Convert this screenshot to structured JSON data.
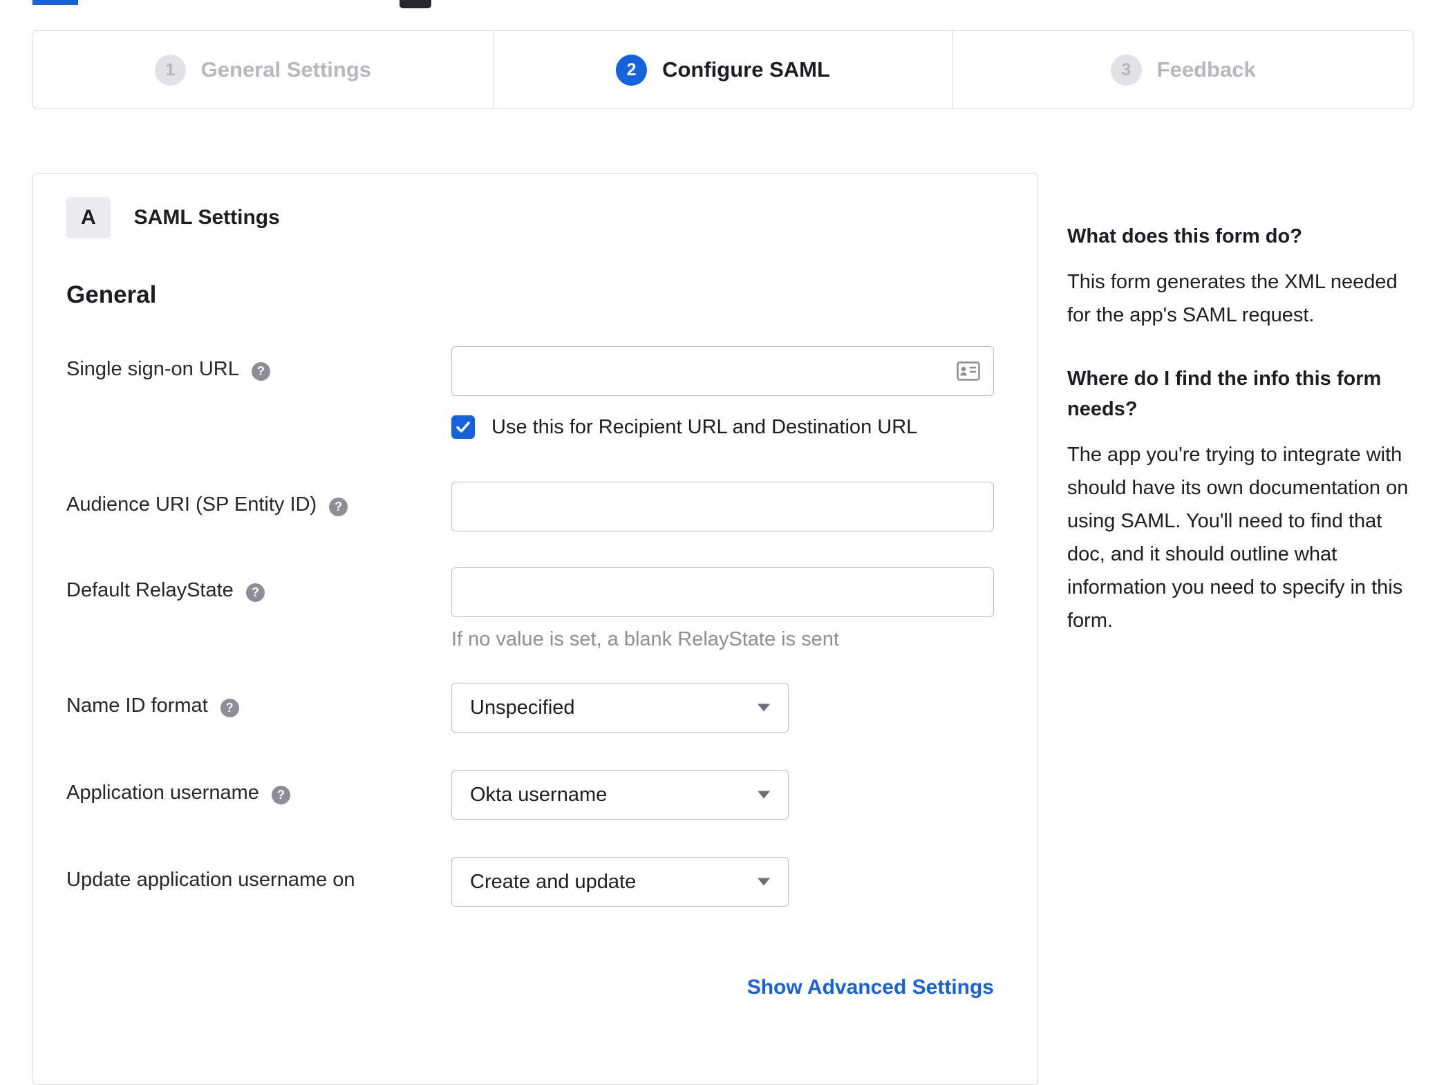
{
  "stepper": {
    "steps": [
      {
        "number": "1",
        "label": "General Settings",
        "state": "inactive"
      },
      {
        "number": "2",
        "label": "Configure SAML",
        "state": "active"
      },
      {
        "number": "3",
        "label": "Feedback",
        "state": "inactive"
      }
    ]
  },
  "panel": {
    "badge": "A",
    "title": "SAML Settings",
    "section_title": "General",
    "fields": {
      "sso": {
        "label": "Single sign-on URL",
        "value": "",
        "checkbox_label": "Use this for Recipient URL and Destination URL",
        "checkbox_checked": true
      },
      "audience": {
        "label": "Audience URI (SP Entity ID)",
        "value": ""
      },
      "relay": {
        "label": "Default RelayState",
        "value": "",
        "hint": "If no value is set, a blank RelayState is sent"
      },
      "nameid": {
        "label": "Name ID format",
        "value": "Unspecified"
      },
      "appuser": {
        "label": "Application username",
        "value": "Okta username"
      },
      "updateuser": {
        "label": "Update application username on",
        "value": "Create and update"
      }
    },
    "advanced_link": "Show Advanced Settings",
    "help_icon_glyph": "?"
  },
  "sidebar": {
    "q1": "What does this form do?",
    "a1": "This form generates the XML needed for the app's SAML request.",
    "q2": "Where do I find the info this form needs?",
    "a2": "The app you're trying to integrate with should have its own documentation on using SAML. You'll need to find that doc, and it should outline what information you need to specify in this form."
  },
  "colors": {
    "accent": "#1662dd",
    "inactive_gray": "#b7b7bf",
    "border": "#d7d7dc",
    "link": "#1662dd"
  }
}
